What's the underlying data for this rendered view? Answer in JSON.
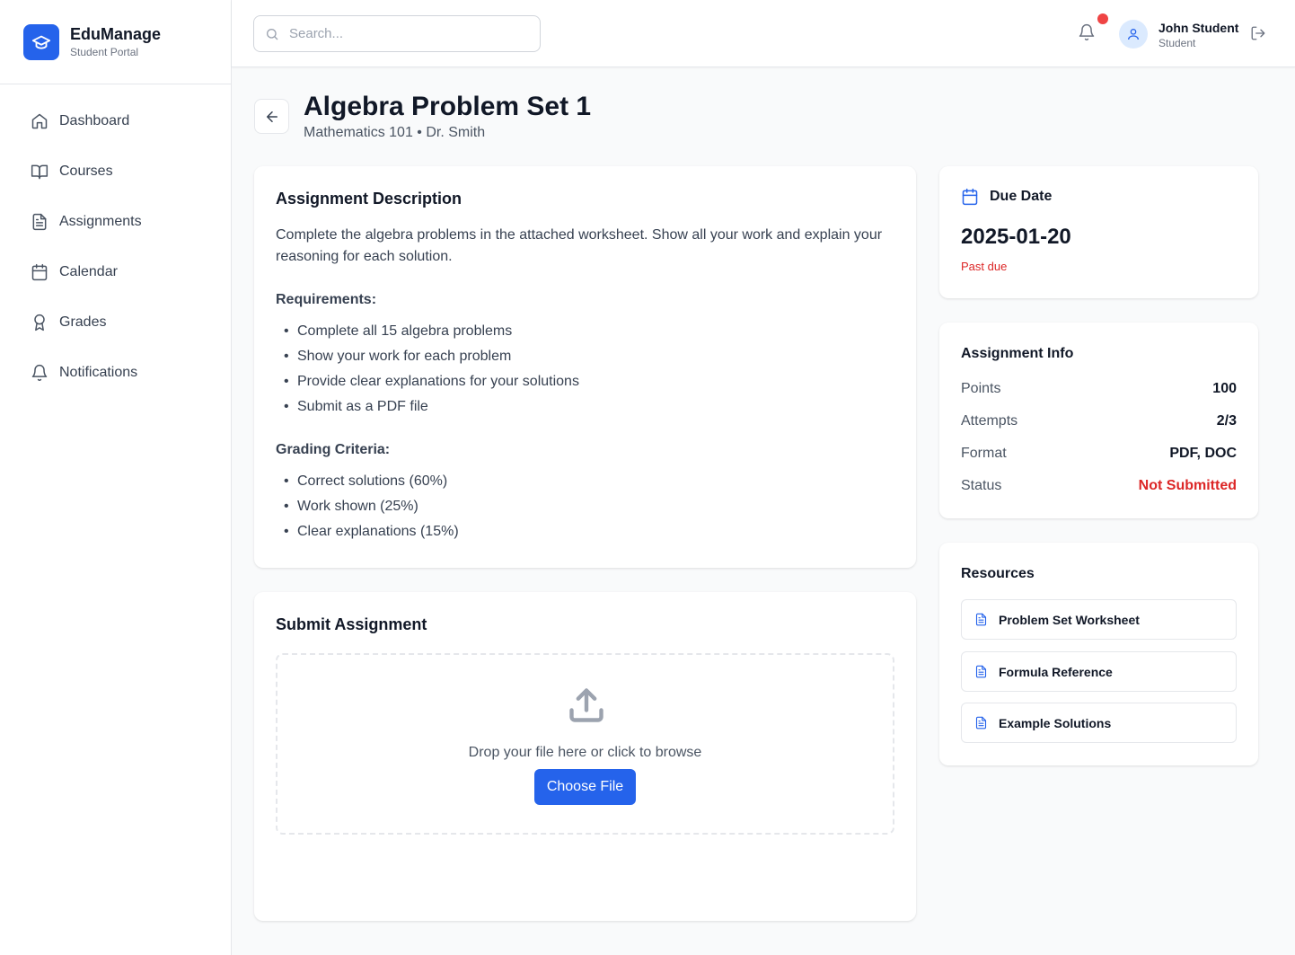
{
  "brand": {
    "name": "EduManage",
    "subtitle": "Student Portal",
    "icon": "graduation-cap-icon"
  },
  "nav": [
    {
      "label": "Dashboard",
      "icon": "home-icon"
    },
    {
      "label": "Courses",
      "icon": "book-open-icon"
    },
    {
      "label": "Assignments",
      "icon": "file-text-icon"
    },
    {
      "label": "Calendar",
      "icon": "calendar-icon"
    },
    {
      "label": "Grades",
      "icon": "award-icon"
    },
    {
      "label": "Notifications",
      "icon": "bell-icon"
    }
  ],
  "header": {
    "search_placeholder": "Search...",
    "user": {
      "name": "John Student",
      "role": "Student"
    },
    "has_unread_notifications": true
  },
  "page": {
    "title": "Algebra Problem Set 1",
    "subtitle": "Mathematics 101 • Dr. Smith"
  },
  "description": {
    "title": "Assignment Description",
    "text": "Complete the algebra problems in the attached worksheet. Show all your work and explain your reasoning for each solution.",
    "requirements_title": "Requirements:",
    "requirements": [
      "Complete all 15 algebra problems",
      "Show your work for each problem",
      "Provide clear explanations for your solutions",
      "Submit as a PDF file"
    ],
    "grading_title": "Grading Criteria:",
    "grading": [
      "Correct solutions (60%)",
      "Work shown (25%)",
      "Clear explanations (15%)"
    ]
  },
  "submit": {
    "title": "Submit Assignment",
    "drop_text": "Drop your file here or click to browse",
    "button": "Choose File"
  },
  "due": {
    "title": "Due Date",
    "date": "2025-01-20",
    "status": "Past due"
  },
  "info": {
    "title": "Assignment Info",
    "rows": [
      {
        "label": "Points",
        "value": "100"
      },
      {
        "label": "Attempts",
        "value": "2/3"
      },
      {
        "label": "Format",
        "value": "PDF, DOC"
      },
      {
        "label": "Status",
        "value": "Not Submitted"
      }
    ]
  },
  "resources": {
    "title": "Resources",
    "items": [
      {
        "label": "Problem Set Worksheet"
      },
      {
        "label": "Formula Reference"
      },
      {
        "label": "Example Solutions"
      }
    ]
  },
  "colors": {
    "primary": "#2563eb",
    "danger": "#dc2626",
    "notification_dot": "#ef4444"
  }
}
